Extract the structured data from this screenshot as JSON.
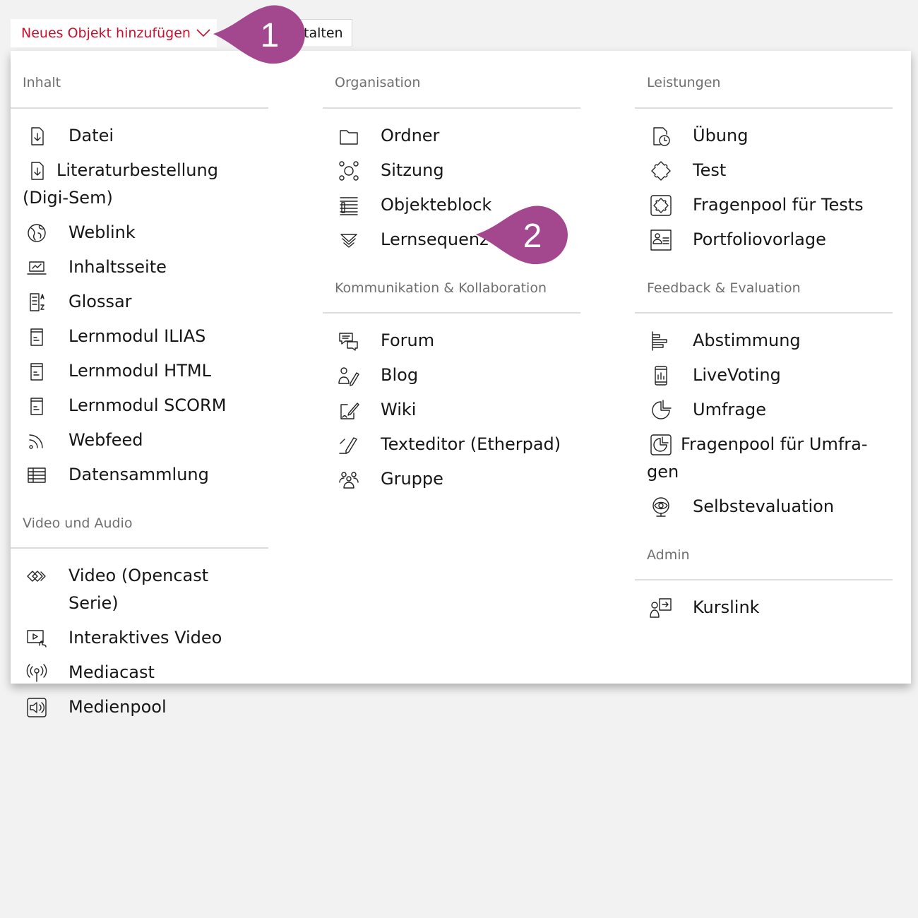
{
  "toolbar": {
    "add_object_label": "Neues Objekt hinzufügen",
    "second_button_label": "talten"
  },
  "callouts": {
    "c1": "1",
    "c2": "2"
  },
  "colors": {
    "accent_red": "#c8102e",
    "callout_purple": "#a3488f",
    "section_gray": "#6f6f6f"
  },
  "col1": {
    "sections": [
      {
        "title": "Inhalt",
        "items": [
          {
            "label": "Datei",
            "icon": "file-download-icon"
          },
          {
            "label": "Literaturbestellung (Digi-Sem)",
            "icon": "file-download-icon"
          },
          {
            "label": "Weblink",
            "icon": "globe-icon"
          },
          {
            "label": "Inhaltsseite",
            "icon": "laptop-icon"
          },
          {
            "label": "Glossar",
            "icon": "glossary-icon"
          },
          {
            "label": "Lernmodul ILIAS",
            "icon": "module-icon"
          },
          {
            "label": "Lernmodul HTML",
            "icon": "module-icon"
          },
          {
            "label": "Lernmodul SCORM",
            "icon": "module-icon"
          },
          {
            "label": "Webfeed",
            "icon": "rss-icon"
          },
          {
            "label": "Datensammlung",
            "icon": "table-icon"
          }
        ]
      },
      {
        "title": "Video und Audio",
        "items": [
          {
            "label": "Video (Opencast Serie)",
            "icon": "opencast-icon"
          },
          {
            "label": "Interaktives Video",
            "icon": "interactive-video-icon"
          },
          {
            "label": "Mediacast",
            "icon": "broadcast-icon"
          },
          {
            "label": "Medienpool",
            "icon": "speaker-icon"
          }
        ]
      }
    ]
  },
  "col2": {
    "sections": [
      {
        "title": "Organisation",
        "items": [
          {
            "label": "Ordner",
            "icon": "folder-icon"
          },
          {
            "label": "Sitzung",
            "icon": "session-icon"
          },
          {
            "label": "Objekteblock",
            "icon": "list-block-icon"
          },
          {
            "label": "Lernsequenz",
            "icon": "sequence-icon"
          }
        ]
      },
      {
        "title": "Kommunikation & Kollaboration",
        "items": [
          {
            "label": "Forum",
            "icon": "forum-icon"
          },
          {
            "label": "Blog",
            "icon": "blog-icon"
          },
          {
            "label": "Wiki",
            "icon": "wiki-icon"
          },
          {
            "label": "Texteditor (Etherpad)",
            "icon": "pen-icon"
          },
          {
            "label": "Gruppe",
            "icon": "group-icon"
          }
        ]
      }
    ]
  },
  "col3": {
    "sections": [
      {
        "title": "Leistungen",
        "items": [
          {
            "label": "Übung",
            "icon": "exercise-icon"
          },
          {
            "label": "Test",
            "icon": "puzzle-icon"
          },
          {
            "label": "Fragenpool für Tests",
            "icon": "puzzle-pool-icon"
          },
          {
            "label": "Portfoliovorlage",
            "icon": "portfolio-icon"
          }
        ]
      },
      {
        "title": "Feedback & Evaluation",
        "items": [
          {
            "label": "Abstimmung",
            "icon": "poll-icon"
          },
          {
            "label": "LiveVoting",
            "icon": "live-voting-icon"
          },
          {
            "label": "Umfrage",
            "icon": "survey-icon"
          },
          {
            "label": "Fragenpool für Umfra-gen",
            "icon": "survey-pool-icon"
          },
          {
            "label": "Selbstevaluation",
            "icon": "self-eval-icon"
          }
        ]
      },
      {
        "title": "Admin",
        "items": [
          {
            "label": "Kurslink",
            "icon": "course-link-icon"
          }
        ]
      }
    ]
  }
}
